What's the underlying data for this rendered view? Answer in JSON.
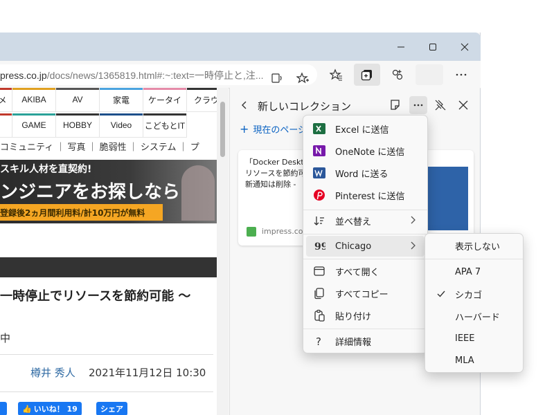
{
  "window": {
    "controls": [
      "minimize-icon",
      "maximize-icon",
      "close-icon"
    ]
  },
  "address": {
    "url_main": "press.co.jp",
    "url_rest": "/docs/news/1365819.html#:~:text=一時停止と,注..."
  },
  "site_nav": {
    "row1": [
      "メ",
      "AKIBA",
      "AV",
      "家電",
      "ケータイ",
      "クラウ"
    ],
    "row2": [
      "",
      "GAME",
      "HOBBY",
      "Video",
      "こどもとIT"
    ],
    "bar_colors": [
      "#c0392b",
      "#e0a020",
      "#555555",
      "#4aa3df",
      "#e58aa8",
      "#333333"
    ]
  },
  "category_nav": "コミュニティ ｜ 写真 ｜ 脆弱性 ｜ システム ｜ プ",
  "banner": {
    "line1": "スキル人材を直契約!",
    "line2": "ンジニアをお探しなら",
    "line3": "登録後2ヵ月間利用料/計10万円が無料"
  },
  "article": {
    "headline": "一時停止でリソースを節約可能 〜",
    "sub": "中",
    "author": "樽井 秀人",
    "date": "2021年11月12日 10:30",
    "like_label": "いいね！ 19",
    "share_label": "シェア"
  },
  "panel": {
    "title": "新しいコレクション",
    "add_current": "現在のページを",
    "card_title_1": "「Docker Deskto",
    "card_title_2": "リソースを節約可能",
    "card_title_3": "新通知は削除 - ",
    "card_source": "impress.co.jp"
  },
  "menu": {
    "items": [
      {
        "label": "Excel に送信",
        "icon": "excel-icon"
      },
      {
        "label": "OneNote に送信",
        "icon": "onenote-icon"
      },
      {
        "label": "Word に送る",
        "icon": "word-icon"
      },
      {
        "label": "Pinterest に送信",
        "icon": "pinterest-icon"
      },
      {
        "label": "並べ替え",
        "icon": "sort-icon"
      },
      {
        "label": "Chicago",
        "icon": "quote-icon"
      },
      {
        "label": "すべて開く",
        "icon": "open-all-icon"
      },
      {
        "label": "すべてコピー",
        "icon": "copy-icon"
      },
      {
        "label": "貼り付け",
        "icon": "paste-icon"
      },
      {
        "label": "詳細情報",
        "icon": "help-icon"
      }
    ]
  },
  "submenu": {
    "items": [
      "表示しない",
      "APA 7",
      "シカゴ",
      "ハーバード",
      "IEEE",
      "MLA"
    ],
    "selected": "シカゴ"
  },
  "colors": {
    "excel": "#1d6f42",
    "onenote": "#7719aa",
    "word": "#2b579a",
    "pinterest": "#e60023",
    "accent": "#0a62c2"
  }
}
